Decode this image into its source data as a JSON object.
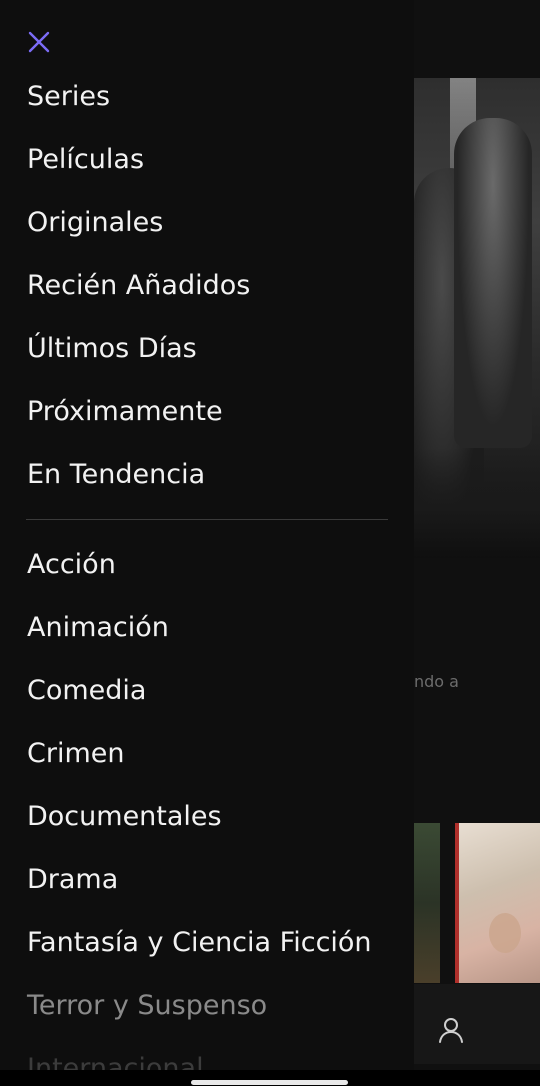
{
  "background": {
    "partial_text": "ndo a"
  },
  "drawer": {
    "close_label": "Cerrar",
    "primary_items": [
      "Series",
      "Películas",
      "Originales",
      "Recién Añadidos",
      "Últimos Días",
      "Próximamente",
      "En Tendencia"
    ],
    "genre_items": [
      "Acción",
      "Animación",
      "Comedia",
      "Crimen",
      "Documentales",
      "Drama",
      "Fantasía y Ciencia Ficción",
      "Terror y Suspenso",
      "Internacional"
    ]
  },
  "colors": {
    "accent": "#7b6cf6",
    "drawer_bg": "#0e0e0e",
    "text": "#f2f2f2"
  },
  "icons": {
    "close": "close-icon",
    "profile": "profile-icon"
  }
}
